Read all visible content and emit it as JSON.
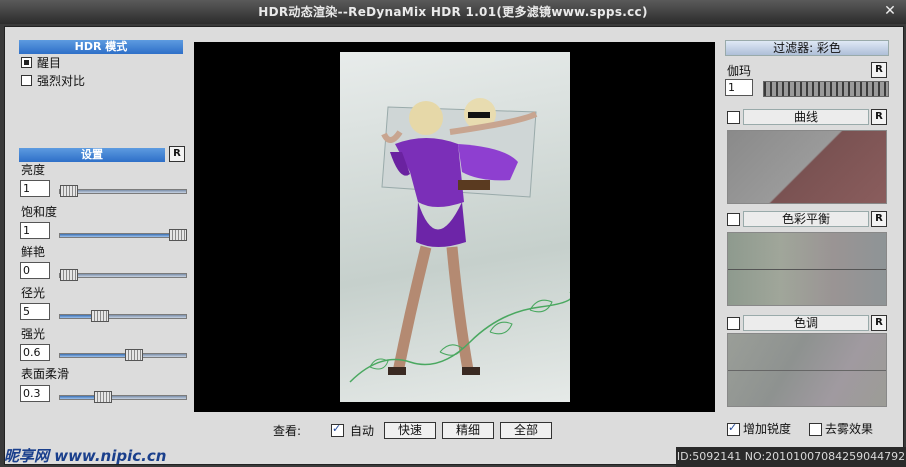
{
  "window": {
    "title": "HDR动态渲染--ReDynaMix HDR 1.01(更多滤镜www.spps.cc)",
    "close": "✕"
  },
  "left": {
    "mode_header": "HDR 模式",
    "modes": [
      {
        "label": "醒目",
        "selected": true
      },
      {
        "label": "强烈对比",
        "selected": false
      }
    ],
    "settings_header": "设置",
    "reset": "R",
    "params": [
      {
        "label": "亮度",
        "value": "1",
        "level": 0.06
      },
      {
        "label": "饱和度",
        "value": "1",
        "level": 0.93
      },
      {
        "label": "鲜艳",
        "value": "0",
        "level": 0.06
      },
      {
        "label": "径光",
        "value": "5",
        "level": 0.31
      },
      {
        "label": "强光",
        "value": "0.6",
        "level": 0.58
      },
      {
        "label": "表面柔滑",
        "value": "0.3",
        "level": 0.33
      }
    ]
  },
  "view": {
    "label": "查看:",
    "auto_label": "自动",
    "auto_checked": true,
    "buttons": [
      "快速",
      "精细",
      "全部"
    ]
  },
  "right": {
    "filter_header": "过滤器: 彩色",
    "gamma_label": "伽玛",
    "gamma_value": "1",
    "reset": "R",
    "sections": [
      {
        "label": "曲线",
        "checked": false
      },
      {
        "label": "色彩平衡",
        "checked": false
      },
      {
        "label": "色调",
        "checked": false
      }
    ],
    "sharpen_label": "增加锐度",
    "sharpen_checked": true,
    "dehaze_label": "去雾效果",
    "dehaze_checked": false
  },
  "watermark": "昵享网 www.nipic.cn",
  "id_text": "ID:5092141 NO:20101007084259044792",
  "colors": {
    "accent": "#2e6fc8",
    "dress": "#7b2fb8"
  }
}
